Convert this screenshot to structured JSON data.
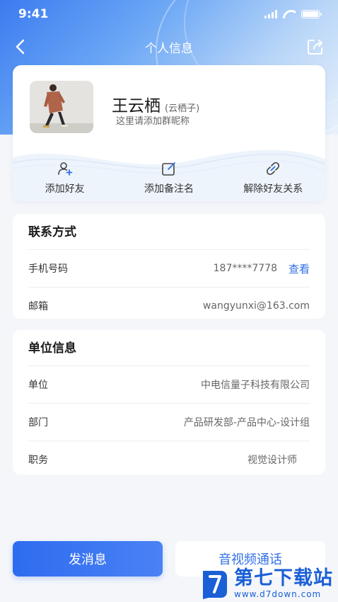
{
  "status_bar": {
    "time": "9:41"
  },
  "nav": {
    "title": "个人信息"
  },
  "profile": {
    "name": "王云栖",
    "alias": "(云栖子)",
    "nickname_hint": "这里请添加群昵称"
  },
  "actions": [
    {
      "label": "添加好友",
      "icon": "add-user-icon"
    },
    {
      "label": "添加备注名",
      "icon": "edit-icon"
    },
    {
      "label": "解除好友关系",
      "icon": "unlink-icon"
    }
  ],
  "contact": {
    "title": "联系方式",
    "phone_label": "手机号码",
    "phone_value": "187****7778",
    "phone_view": "查看",
    "email_label": "邮箱",
    "email_value": "wangyunxi@163.com"
  },
  "work": {
    "title": "单位信息",
    "rows": [
      {
        "label": "单位",
        "value": "中电信量子科技有限公司"
      },
      {
        "label": "部门",
        "value": "产品研发部-产品中心-设计组"
      },
      {
        "label": "职务",
        "value": "视觉设计师"
      }
    ]
  },
  "buttons": {
    "message": "发消息",
    "call": "音视频通话"
  },
  "watermark": {
    "name": "第七下载站",
    "url": "www.d7down.com"
  },
  "colors": {
    "accent": "#2f6fe8",
    "background": "#f4f6fa"
  }
}
